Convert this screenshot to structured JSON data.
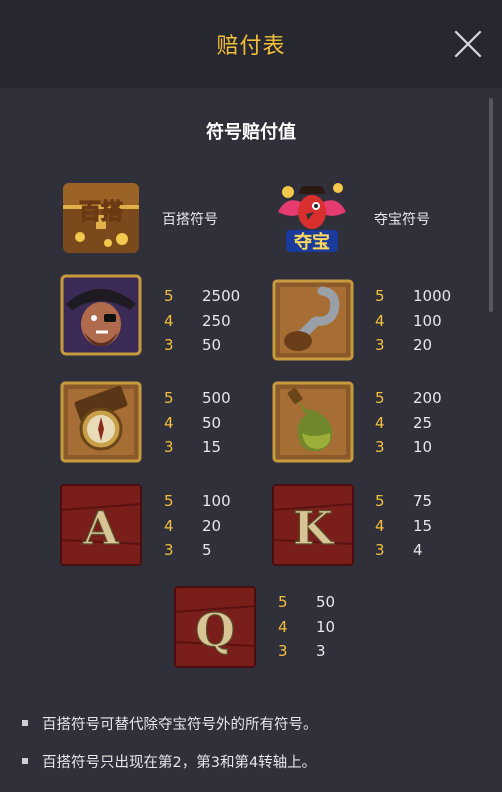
{
  "header": {
    "title": "赔付表"
  },
  "section": {
    "title": "符号赔付值"
  },
  "symbols": [
    {
      "name": "百搭符号",
      "icon": "wild-treasure-chest-icon"
    },
    {
      "name": "夺宝符号",
      "icon": "scatter-parrot-icon"
    }
  ],
  "paytable": [
    {
      "icon": "pirate-captain-icon",
      "rows": [
        {
          "count": "5",
          "value": "2500"
        },
        {
          "count": "4",
          "value": "250"
        },
        {
          "count": "3",
          "value": "50"
        }
      ]
    },
    {
      "icon": "hook-icon",
      "rows": [
        {
          "count": "5",
          "value": "1000"
        },
        {
          "count": "4",
          "value": "100"
        },
        {
          "count": "3",
          "value": "20"
        }
      ]
    },
    {
      "icon": "compass-icon",
      "rows": [
        {
          "count": "5",
          "value": "500"
        },
        {
          "count": "4",
          "value": "50"
        },
        {
          "count": "3",
          "value": "15"
        }
      ]
    },
    {
      "icon": "rum-bottle-icon",
      "rows": [
        {
          "count": "5",
          "value": "200"
        },
        {
          "count": "4",
          "value": "25"
        },
        {
          "count": "3",
          "value": "10"
        }
      ]
    },
    {
      "icon": "letter-a-icon",
      "letter": "A",
      "rows": [
        {
          "count": "5",
          "value": "100"
        },
        {
          "count": "4",
          "value": "20"
        },
        {
          "count": "3",
          "value": "5"
        }
      ]
    },
    {
      "icon": "letter-k-icon",
      "letter": "K",
      "rows": [
        {
          "count": "5",
          "value": "75"
        },
        {
          "count": "4",
          "value": "15"
        },
        {
          "count": "3",
          "value": "4"
        }
      ]
    },
    {
      "icon": "letter-q-icon",
      "letter": "Q",
      "rows": [
        {
          "count": "5",
          "value": "50"
        },
        {
          "count": "4",
          "value": "10"
        },
        {
          "count": "3",
          "value": "3"
        }
      ]
    }
  ],
  "wild_badge": "百搭",
  "scatter_badge": "夺宝",
  "notes": [
    "百搭符号可替代除夺宝符号外的所有符号。",
    "百搭符号只出现在第2，第3和第4转轴上。"
  ],
  "colors": {
    "accent": "#f4bf3a",
    "background": "#2f303a",
    "header": "#26272f"
  }
}
